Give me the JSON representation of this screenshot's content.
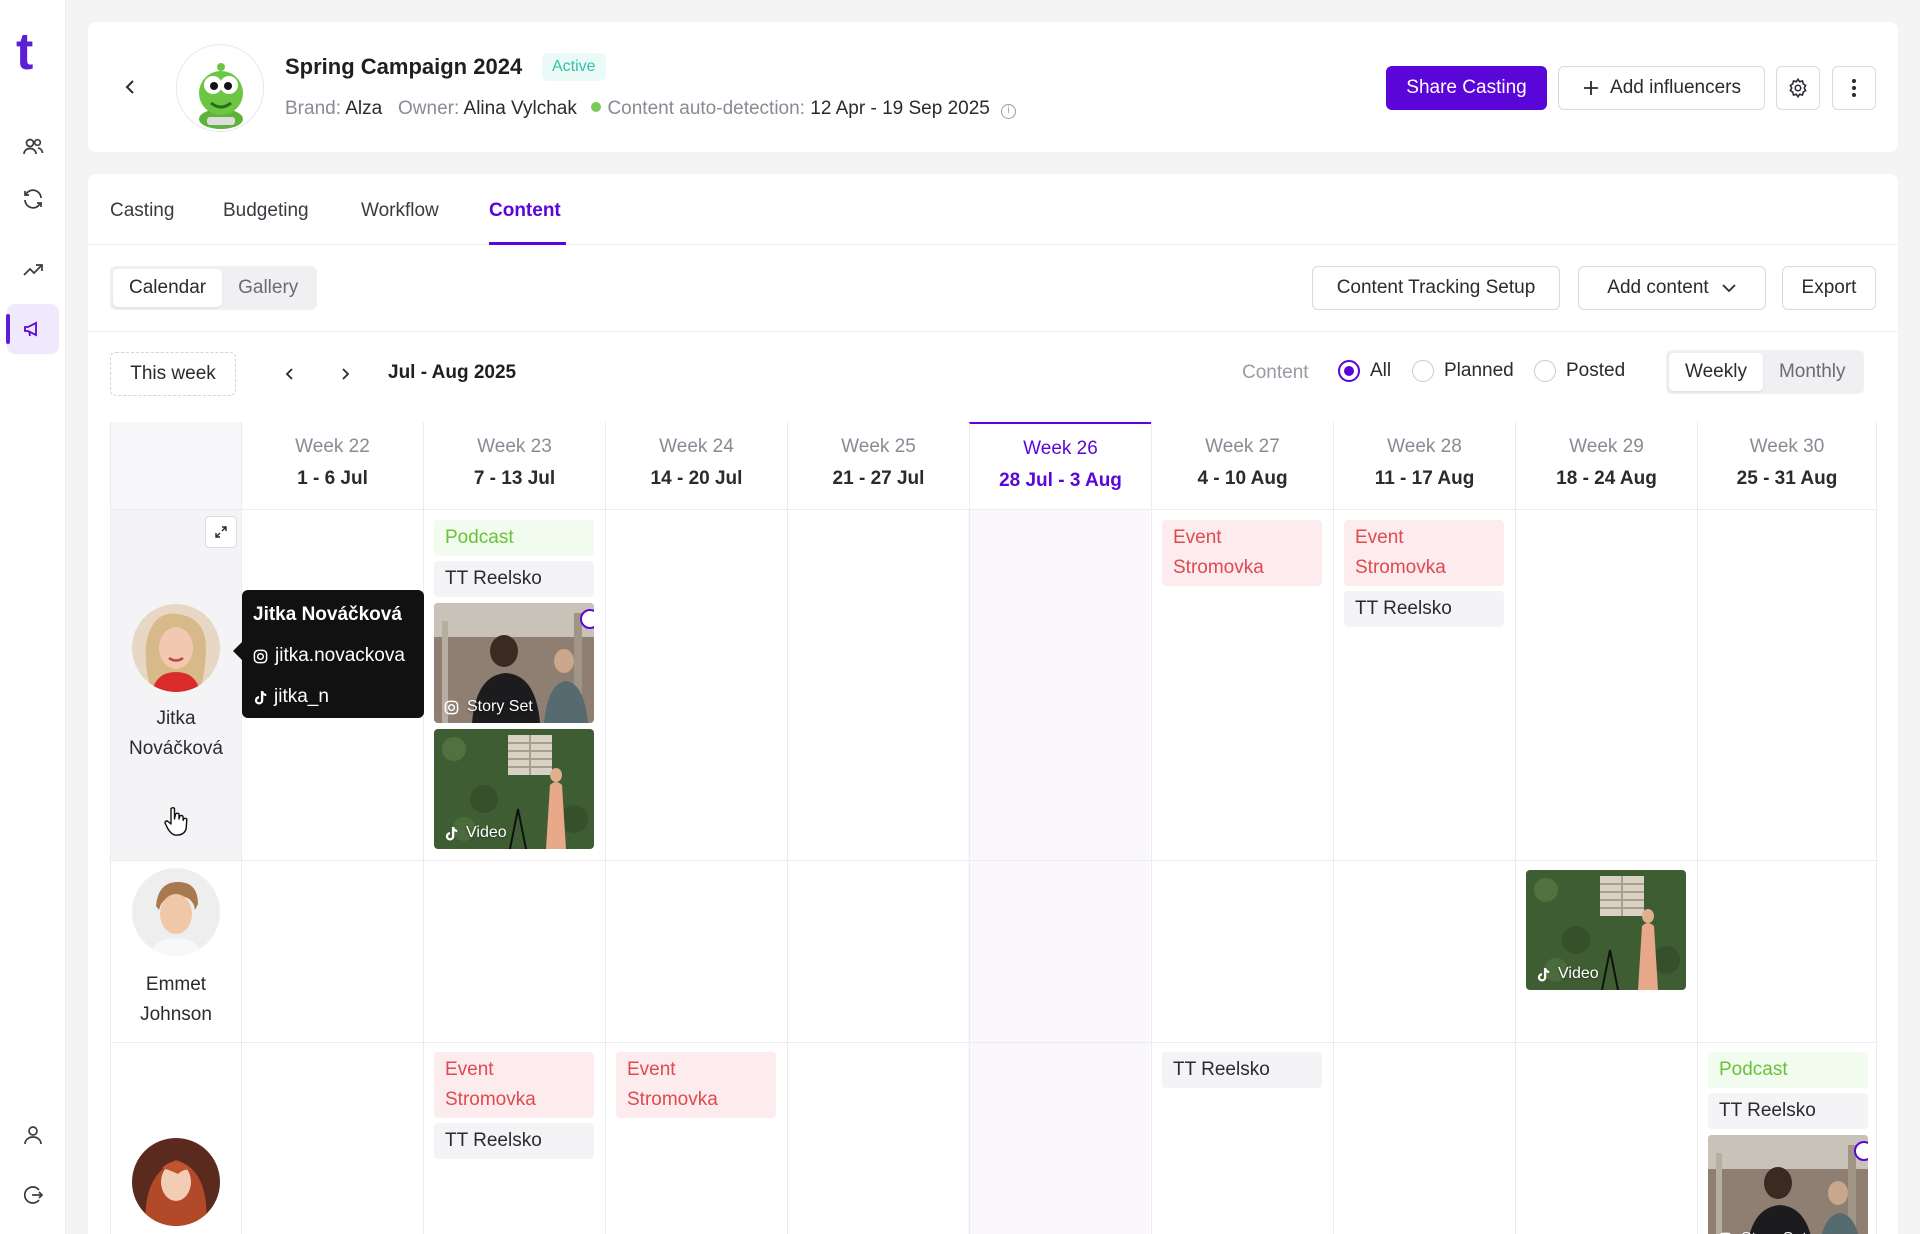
{
  "app": {
    "logo": "t"
  },
  "rail": {
    "items": [
      {
        "icon": "users-icon"
      },
      {
        "icon": "sync-icon"
      },
      {
        "icon": "trend-icon"
      },
      {
        "icon": "megaphone-icon",
        "active": true
      }
    ],
    "bottom": [
      {
        "icon": "profile-icon"
      },
      {
        "icon": "logout-icon"
      }
    ]
  },
  "header": {
    "title": "Spring Campaign 2024",
    "status": "Active",
    "brand_label": "Brand:",
    "brand": "Alza",
    "owner_label": "Owner:",
    "owner": "Alina Vylchak",
    "detection_label": "Content auto-detection:",
    "detection_range": "12 Apr - 19 Sep 2025",
    "share_label": "Share Casting",
    "add_influencers_label": "Add influencers"
  },
  "tabs": [
    "Casting",
    "Budgeting",
    "Workflow",
    "Content"
  ],
  "active_tab": "Content",
  "view_toggle": {
    "calendar": "Calendar",
    "gallery": "Gallery",
    "selected": "Calendar"
  },
  "actions": {
    "tracking": "Content Tracking Setup",
    "add_content": "Add content",
    "export": "Export"
  },
  "calendar": {
    "this_week": "This week",
    "range": "Jul - Aug 2025",
    "content_label": "Content",
    "filters": [
      {
        "label": "All",
        "selected": true
      },
      {
        "label": "Planned",
        "selected": false
      },
      {
        "label": "Posted",
        "selected": false
      }
    ],
    "period": {
      "weekly": "Weekly",
      "monthly": "Monthly",
      "selected": "Weekly"
    },
    "weeks": [
      {
        "week": "Week 22",
        "dates": "1 - 6 Jul"
      },
      {
        "week": "Week 23",
        "dates": "7 - 13 Jul"
      },
      {
        "week": "Week 24",
        "dates": "14 - 20 Jul"
      },
      {
        "week": "Week 25",
        "dates": "21 - 27 Jul"
      },
      {
        "week": "Week 26",
        "dates": "28 Jul - 3 Aug",
        "current": true
      },
      {
        "week": "Week 27",
        "dates": "4 - 10 Aug"
      },
      {
        "week": "Week 28",
        "dates": "11 - 17 Aug"
      },
      {
        "week": "Week 29",
        "dates": "18 - 24 Aug"
      },
      {
        "week": "Week 30",
        "dates": "25 - 31 Aug"
      }
    ],
    "influencers": [
      {
        "name_line1": "Jitka",
        "name_line2": "Nováčková"
      },
      {
        "name_line1": "Emmet",
        "name_line2": "Johnson"
      },
      {
        "name_line1": "",
        "name_line2": ""
      }
    ],
    "items": {
      "podcast": "Podcast",
      "tt_reelsko": "TT Reelsko",
      "event_line1": "Event",
      "event_line2": "Stromovka",
      "story_set": "Story Set",
      "video": "Video"
    },
    "tooltip": {
      "name": "Jitka Nováčková",
      "instagram": "jitka.novackova",
      "tiktok": "jitka_n"
    }
  },
  "colors": {
    "accent": "#5b06d9",
    "podcast": "#67c23a",
    "event": "#e0494f",
    "active": "#35c0a8"
  }
}
